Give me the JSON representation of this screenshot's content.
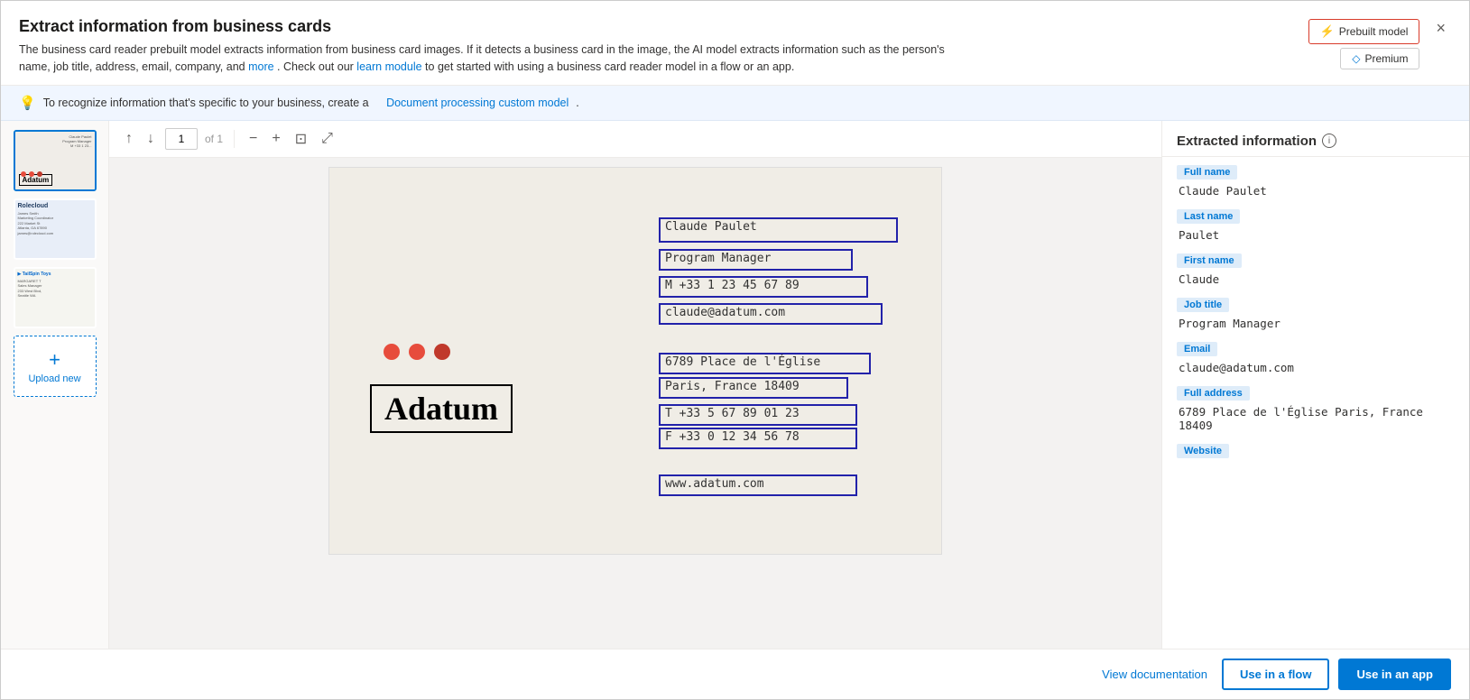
{
  "dialog": {
    "title": "Extract information from business cards",
    "description": "The business card reader prebuilt model extracts information from business card images. If it detects a business card in the image, the AI model extracts information such as the person's name, job title, address, email, company, and",
    "more_link": "more",
    "suffix": ". Check out our",
    "learn_link": "learn module",
    "learn_suffix": " to get started with using a business card reader model in a flow or an app.",
    "close_label": "×"
  },
  "prebuilt_btn": {
    "label": "Prebuilt model"
  },
  "premium_btn": {
    "label": "Premium"
  },
  "banner": {
    "text": "To recognize information that's specific to your business, create a",
    "link_text": "Document processing custom model",
    "suffix": "."
  },
  "toolbar": {
    "prev_label": "↑",
    "next_label": "↓",
    "page_value": "1",
    "page_of": "of 1",
    "zoom_out": "−",
    "zoom_in": "+",
    "fit_page": "⊡",
    "expand": "⤢"
  },
  "thumbnails": [
    {
      "id": "thumb1",
      "label": "Adatum card",
      "active": true
    },
    {
      "id": "thumb2",
      "label": "Rolecloud card",
      "active": false
    },
    {
      "id": "thumb3",
      "label": "Tailspin Toys card",
      "active": false
    }
  ],
  "upload_btn": {
    "plus": "+",
    "label": "Upload new"
  },
  "business_card": {
    "name": "Claude Paulet",
    "title": "Program Manager",
    "phone": "M +33 1 23 45 67 89",
    "email": "claude@adatum.com",
    "address1": "6789 Place de l'Église",
    "address2": "Paris, France 18409",
    "tel": "T +33 5 67 89 01 23",
    "fax": "F +33 0 12 34 56 78",
    "website": "www.adatum.com",
    "company": "Adatum"
  },
  "extracted": {
    "section_title": "Extracted information",
    "info_icon": "i",
    "fields": [
      {
        "tag": "Full name",
        "value": "Claude  Paulet"
      },
      {
        "tag": "Last name",
        "value": "Paulet"
      },
      {
        "tag": "First name",
        "value": "Claude"
      },
      {
        "tag": "Job title",
        "value": "Program  Manager"
      },
      {
        "tag": "Email",
        "value": "claude@adatum.com"
      },
      {
        "tag": "Full address",
        "value": "6789 Place de l'Église Paris, France 18409"
      },
      {
        "tag": "Website",
        "value": ""
      }
    ]
  },
  "footer": {
    "view_docs": "View documentation",
    "use_flow": "Use in a flow",
    "use_app": "Use in an app"
  }
}
